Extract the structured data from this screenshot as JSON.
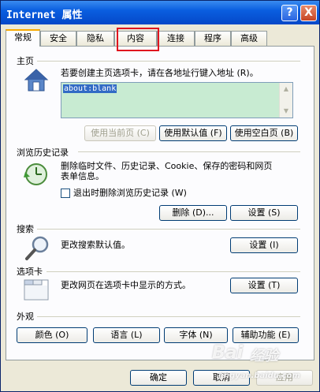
{
  "window": {
    "title": "Internet 属性",
    "help": "?",
    "close": "X"
  },
  "tabs": [
    "常规",
    "安全",
    "隐私",
    "内容",
    "连接",
    "程序",
    "高级"
  ],
  "home": {
    "section": "主页",
    "desc": "若要创建主页选项卡，请在各地址行键入地址 (R)。",
    "address": "about:blank",
    "buttons": [
      "使用当前页 (C)",
      "使用默认值 (F)",
      "使用空白页 (B)"
    ]
  },
  "history": {
    "section": "浏览历史记录",
    "desc1": "删除临时文件、历史记录、Cookie、保存的密码和网页",
    "desc2": "表单信息。",
    "checkbox": "退出时删除浏览历史记录 (W)",
    "buttons": [
      "删除 (D)...",
      "设置 (S)"
    ]
  },
  "search": {
    "section": "搜索",
    "desc": "更改搜索默认值。",
    "button": "设置 (I)"
  },
  "tabsec": {
    "section": "选项卡",
    "desc": "更改网页在选项卡中显示的方式。",
    "button": "设置 (T)"
  },
  "appearance": {
    "section": "外观",
    "buttons": [
      "颜色 (O)",
      "语言 (L)",
      "字体 (N)",
      "辅助功能 (E)"
    ]
  },
  "footer": {
    "buttons": [
      "确定",
      "取消",
      "应用"
    ]
  },
  "watermark": {
    "text1": "Bai",
    "text2": "经验",
    "text3": "jingyan.baidu.com"
  }
}
